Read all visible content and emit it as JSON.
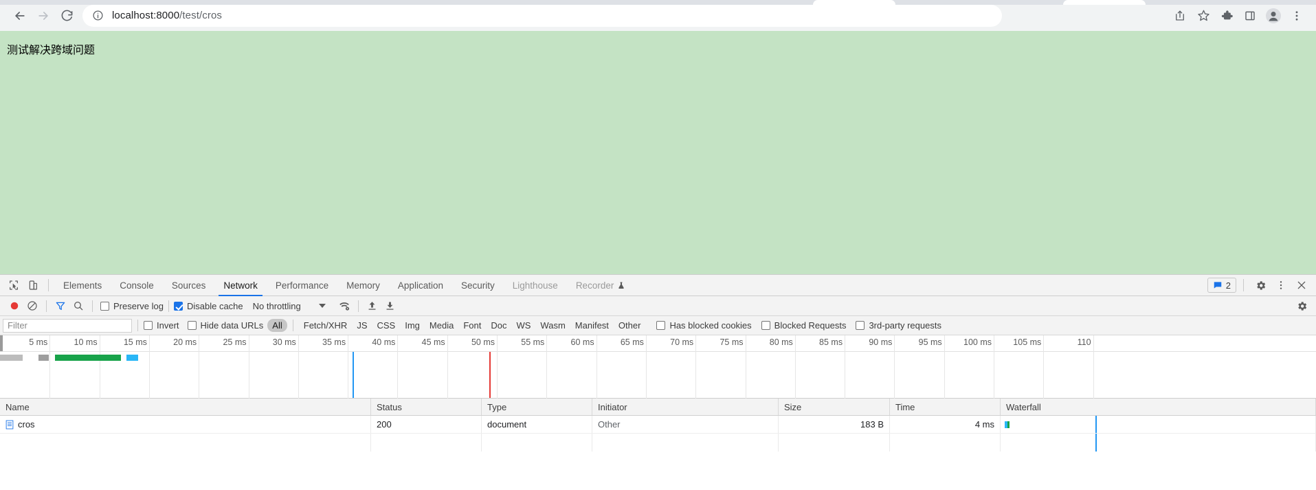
{
  "browser": {
    "nav": {
      "back": "back-arrow",
      "forward": "forward-arrow",
      "reload": "reload-icon"
    },
    "omnibox": {
      "info_icon": "info-circle-icon",
      "url_host": "localhost:8000",
      "url_path": "/test/cros",
      "full_url": "localhost:8000/test/cros"
    },
    "actions": [
      "share-icon",
      "bookmark-star-icon",
      "extensions-puzzle-icon",
      "side-panel-icon",
      "profile-avatar-icon",
      "browser-menu-icon"
    ]
  },
  "page": {
    "heading": "测试解决跨域问题",
    "background_color": "#c4e3c4"
  },
  "devtools": {
    "left_icons": [
      "inspect-element-icon",
      "device-toolbar-icon"
    ],
    "tabs": [
      {
        "label": "Elements",
        "active": false,
        "dim": false
      },
      {
        "label": "Console",
        "active": false,
        "dim": false
      },
      {
        "label": "Sources",
        "active": false,
        "dim": false
      },
      {
        "label": "Network",
        "active": true,
        "dim": false
      },
      {
        "label": "Performance",
        "active": false,
        "dim": false
      },
      {
        "label": "Memory",
        "active": false,
        "dim": false
      },
      {
        "label": "Application",
        "active": false,
        "dim": false
      },
      {
        "label": "Security",
        "active": false,
        "dim": false
      },
      {
        "label": "Lighthouse",
        "active": false,
        "dim": true
      },
      {
        "label": "Recorder",
        "active": false,
        "dim": true
      }
    ],
    "message_count": "2",
    "right_icons": [
      "settings-gear-icon",
      "devtools-more-icon",
      "close-devtools-icon"
    ],
    "accent_color": "#1a73e8"
  },
  "network_toolbar": {
    "record_label": "record-button",
    "clear_label": "clear-button",
    "filter_label": "filter-toggle",
    "search_label": "search-button",
    "preserve_log": {
      "label": "Preserve log",
      "checked": false
    },
    "disable_cache": {
      "label": "Disable cache",
      "checked": true
    },
    "throttling": "No throttling",
    "network_conditions": "network-conditions-icon",
    "import_har": "import-har-icon",
    "export_har": "export-har-icon",
    "settings": "network-settings-icon"
  },
  "filter_bar": {
    "placeholder": "Filter",
    "value": "",
    "invert": {
      "label": "Invert",
      "checked": false
    },
    "hide_data_urls": {
      "label": "Hide data URLs",
      "checked": false
    },
    "types": [
      {
        "label": "All",
        "selected": true
      },
      {
        "label": "Fetch/XHR",
        "selected": false
      },
      {
        "label": "JS",
        "selected": false
      },
      {
        "label": "CSS",
        "selected": false
      },
      {
        "label": "Img",
        "selected": false
      },
      {
        "label": "Media",
        "selected": false
      },
      {
        "label": "Font",
        "selected": false
      },
      {
        "label": "Doc",
        "selected": false
      },
      {
        "label": "WS",
        "selected": false
      },
      {
        "label": "Wasm",
        "selected": false
      },
      {
        "label": "Manifest",
        "selected": false
      },
      {
        "label": "Other",
        "selected": false
      }
    ],
    "has_blocked_cookies": {
      "label": "Has blocked cookies",
      "checked": false
    },
    "blocked_requests": {
      "label": "Blocked Requests",
      "checked": false
    },
    "third_party_requests": {
      "label": "3rd-party requests",
      "checked": false
    }
  },
  "overview": {
    "ticks": [
      "5 ms",
      "10 ms",
      "15 ms",
      "20 ms",
      "25 ms",
      "30 ms",
      "35 ms",
      "40 ms",
      "45 ms",
      "50 ms",
      "55 ms",
      "60 ms",
      "65 ms",
      "70 ms",
      "75 ms",
      "80 ms",
      "85 ms",
      "90 ms",
      "95 ms",
      "100 ms",
      "105 ms",
      "110"
    ],
    "dom_content_loaded_color": "#2196f3",
    "load_event_color": "#e53935",
    "bars": [
      {
        "name": "queueing",
        "color": "#bcbcbc",
        "start_pct": 0.0,
        "width_pct": 1.7
      },
      {
        "name": "stalled",
        "color": "#9e9e9e",
        "start_pct": 2.9,
        "width_pct": 0.8
      },
      {
        "name": "downloading",
        "color": "#18a34a",
        "start_pct": 4.2,
        "width_pct": 5.0
      },
      {
        "name": "receiving",
        "color": "#29b6f6",
        "start_pct": 9.6,
        "width_pct": 0.9
      }
    ]
  },
  "table": {
    "columns": [
      "Name",
      "Status",
      "Type",
      "Initiator",
      "Size",
      "Time",
      "Waterfall"
    ],
    "rows": [
      {
        "icon": "document-icon",
        "name": "cros",
        "status": "200",
        "type": "document",
        "initiator": "Other",
        "size": "183 B",
        "time": "4 ms"
      }
    ]
  }
}
